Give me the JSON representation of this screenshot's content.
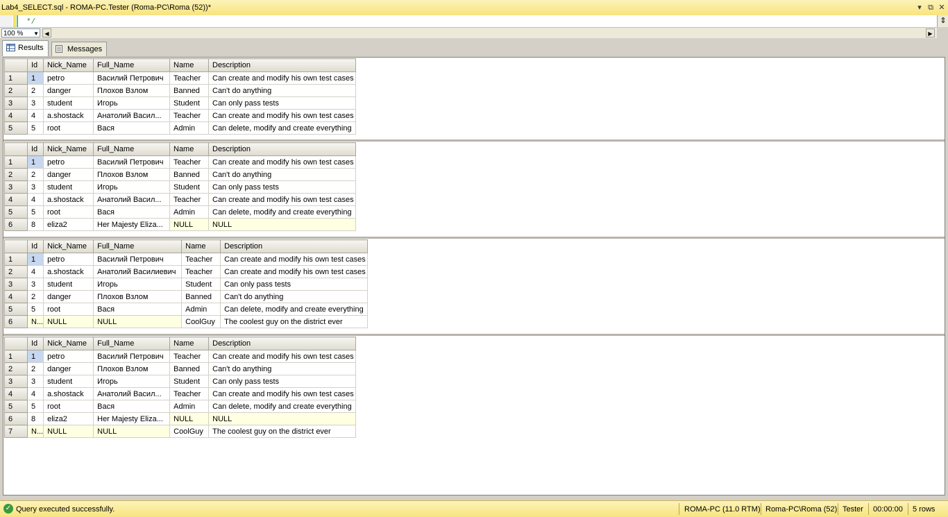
{
  "window": {
    "title": "Lab4_SELECT.sql - ROMA-PC.Tester (Roma-PC\\Roma (52))*",
    "buttons": [
      "▾",
      "⧉",
      "✕"
    ]
  },
  "editor": {
    "visible_code": "*/"
  },
  "zoom": {
    "value": "100 %"
  },
  "tabs": [
    {
      "label": "Results",
      "active": true
    },
    {
      "label": "Messages",
      "active": false
    }
  ],
  "grids": [
    {
      "columns": [
        "Id",
        "Nick_Name",
        "Full_Name",
        "Name",
        "Description"
      ],
      "rows": [
        [
          "1",
          "1",
          "petro",
          "Василий Петрович",
          "Teacher",
          "Can create and modify his own test cases"
        ],
        [
          "2",
          "2",
          "danger",
          "Плохов Взлом",
          "Banned",
          "Can't do anything"
        ],
        [
          "3",
          "3",
          "student",
          "Игорь",
          "Student",
          "Can only pass tests"
        ],
        [
          "4",
          "4",
          "a.shostack",
          "Анатолий Васил...",
          "Teacher",
          "Can create and modify his own test cases"
        ],
        [
          "5",
          "5",
          "root",
          "Вася",
          "Admin",
          "Can delete, modify and create everything"
        ]
      ]
    },
    {
      "columns": [
        "Id",
        "Nick_Name",
        "Full_Name",
        "Name",
        "Description"
      ],
      "rows": [
        [
          "1",
          "1",
          "petro",
          "Василий Петрович",
          "Teacher",
          "Can create and modify his own test cases"
        ],
        [
          "2",
          "2",
          "danger",
          "Плохов Взлом",
          "Banned",
          "Can't do anything"
        ],
        [
          "3",
          "3",
          "student",
          "Игорь",
          "Student",
          "Can only pass tests"
        ],
        [
          "4",
          "4",
          "a.shostack",
          "Анатолий Васил...",
          "Teacher",
          "Can create and modify his own test cases"
        ],
        [
          "5",
          "5",
          "root",
          "Вася",
          "Admin",
          "Can delete, modify and create everything"
        ],
        [
          "6",
          "8",
          "eliza2",
          "Her Majesty Eliza...",
          "NULL",
          "NULL"
        ]
      ]
    },
    {
      "columns": [
        "Id",
        "Nick_Name",
        "Full_Name",
        "Name",
        "Description"
      ],
      "rows": [
        [
          "1",
          "1",
          "petro",
          "Василий Петрович",
          "Teacher",
          "Can create and modify his own test cases"
        ],
        [
          "2",
          "4",
          "a.shostack",
          "Анатолий Василиевич",
          "Teacher",
          "Can create and modify his own test cases"
        ],
        [
          "3",
          "3",
          "student",
          "Игорь",
          "Student",
          "Can only pass tests"
        ],
        [
          "4",
          "2",
          "danger",
          "Плохов Взлом",
          "Banned",
          "Can't do anything"
        ],
        [
          "5",
          "5",
          "root",
          "Вася",
          "Admin",
          "Can delete, modify and create everything"
        ],
        [
          "6",
          "N...",
          "NULL",
          "NULL",
          "CoolGuy",
          "The coolest guy on the district ever"
        ]
      ]
    },
    {
      "columns": [
        "Id",
        "Nick_Name",
        "Full_Name",
        "Name",
        "Description"
      ],
      "rows": [
        [
          "1",
          "1",
          "petro",
          "Василий Петрович",
          "Teacher",
          "Can create and modify his own test cases"
        ],
        [
          "2",
          "2",
          "danger",
          "Плохов Взлом",
          "Banned",
          "Can't do anything"
        ],
        [
          "3",
          "3",
          "student",
          "Игорь",
          "Student",
          "Can only pass tests"
        ],
        [
          "4",
          "4",
          "a.shostack",
          "Анатолий Васил...",
          "Teacher",
          "Can create and modify his own test cases"
        ],
        [
          "5",
          "5",
          "root",
          "Вася",
          "Admin",
          "Can delete, modify and create everything"
        ],
        [
          "6",
          "8",
          "eliza2",
          "Her Majesty Eliza...",
          "NULL",
          "NULL"
        ],
        [
          "7",
          "N...",
          "NULL",
          "NULL",
          "CoolGuy",
          "The coolest guy on the district ever"
        ]
      ]
    }
  ],
  "status": {
    "message": "Query executed successfully.",
    "server": "ROMA-PC (11.0 RTM)",
    "login": "Roma-PC\\Roma (52)",
    "database": "Tester",
    "elapsed": "00:00:00",
    "rows": "5 rows"
  }
}
